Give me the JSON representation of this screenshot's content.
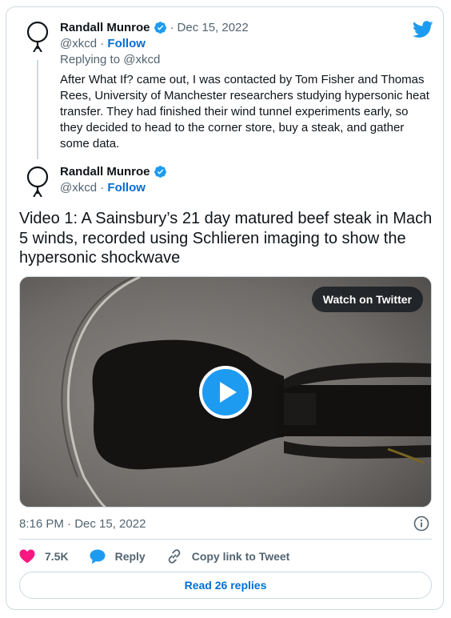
{
  "header": {
    "logo_icon": "twitter-bird-icon",
    "brand_color": "#1d9bf0"
  },
  "reply_tweet": {
    "author": {
      "name": "Randall Munroe",
      "handle": "@xkcd",
      "verified": true,
      "avatar_icon": "stick-figure-avatar"
    },
    "separator": "·",
    "date": "Dec 15, 2022",
    "follow_label": "Follow",
    "handle_sep": "·",
    "replying_to": "Replying to @xkcd",
    "text": "After What If? came out, I was contacted by Tom Fisher and Thomas Rees, University of Manchester researchers studying hypersonic heat transfer. They had finished their wind tunnel experiments early, so they decided to head to the corner store, buy a steak, and gather some data."
  },
  "main_tweet": {
    "author": {
      "name": "Randall Munroe",
      "handle": "@xkcd",
      "verified": true,
      "avatar_icon": "stick-figure-avatar"
    },
    "follow_label": "Follow",
    "handle_sep": "·",
    "text": "Video 1: A Sainsbury’s 21 day matured beef steak in Mach 5 winds, recorded using Schlieren imaging to show the hypersonic shockwave",
    "video": {
      "watch_label": "Watch on Twitter",
      "play_icon": "play-icon"
    },
    "timestamp": "8:16 PM · Dec 15, 2022",
    "info_icon": "info-icon"
  },
  "actions": {
    "like": {
      "icon": "heart-icon",
      "count": "7.5K",
      "color": "#f91880"
    },
    "reply": {
      "icon": "speech-bubble-icon",
      "label": "Reply",
      "color": "#1d9bf0"
    },
    "copy": {
      "icon": "link-icon",
      "label": "Copy link to Tweet"
    }
  },
  "read_replies_label": "Read 26 replies"
}
